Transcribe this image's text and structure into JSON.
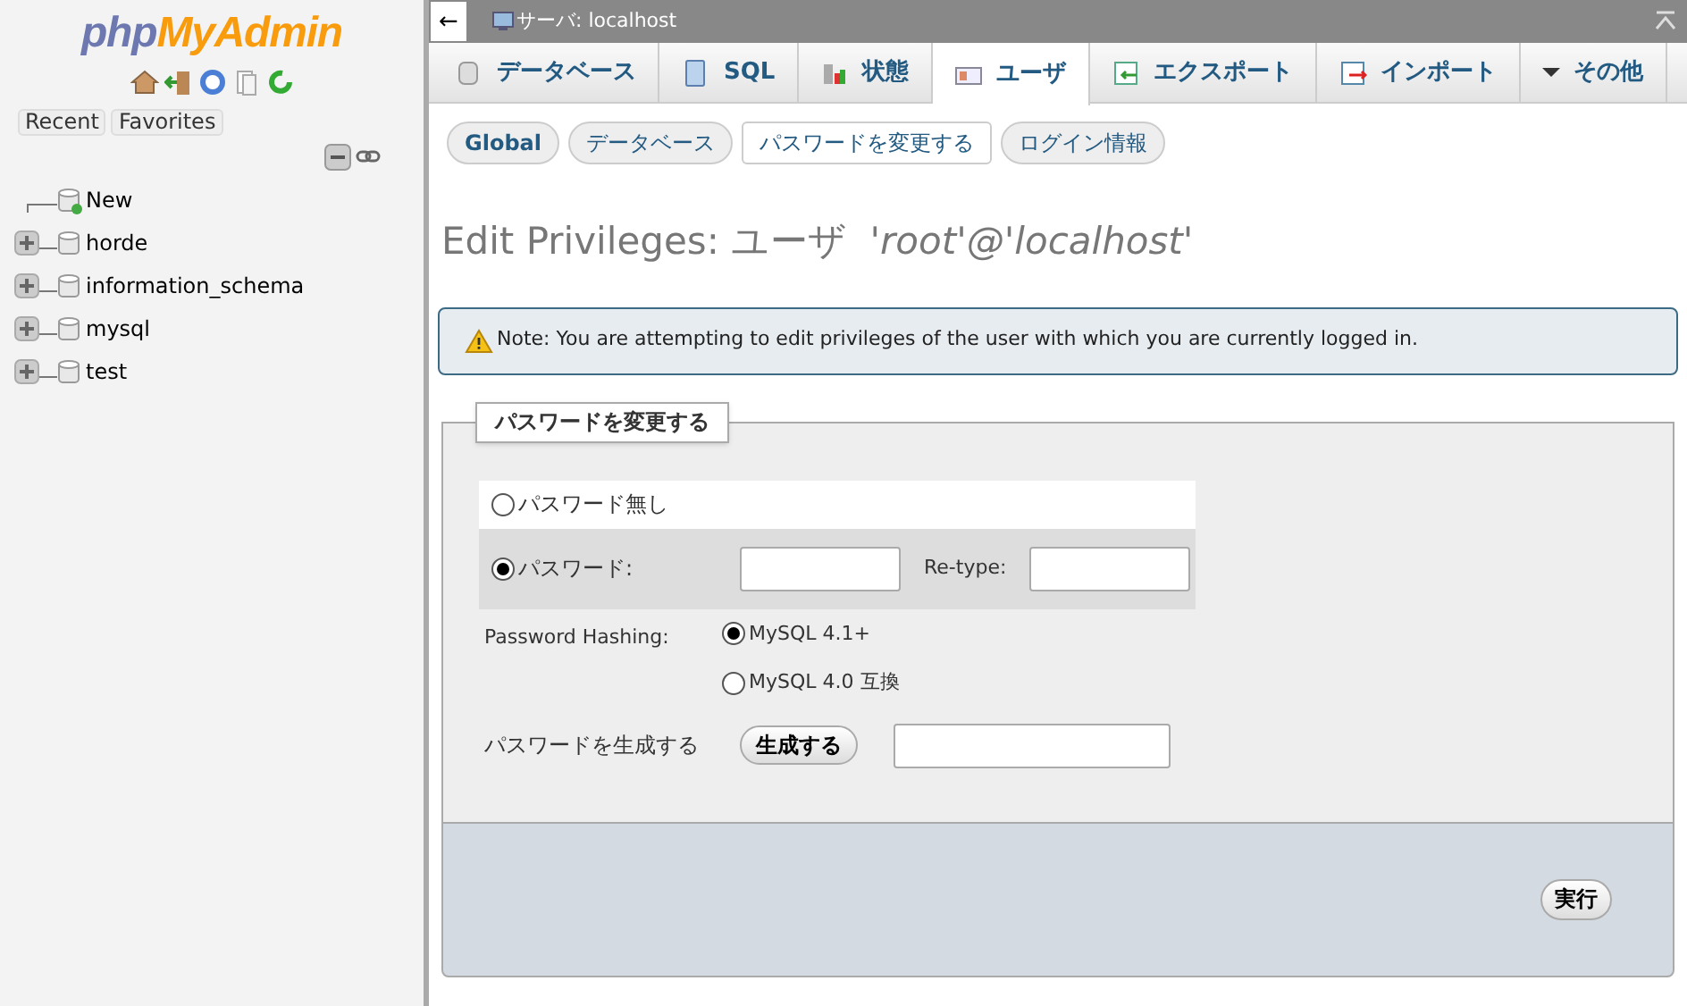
{
  "logo": {
    "php": "php",
    "admin": "MyAdmin"
  },
  "sidebar_tabs": [
    "Recent",
    "Favorites"
  ],
  "tree": [
    {
      "kind": "new",
      "label": "New"
    },
    {
      "kind": "db",
      "label": "horde"
    },
    {
      "kind": "db",
      "label": "information_schema"
    },
    {
      "kind": "db",
      "label": "mysql"
    },
    {
      "kind": "db",
      "label": "test"
    }
  ],
  "topbar": {
    "back": "←",
    "server": "サーバ: localhost"
  },
  "tabs": [
    {
      "kind": "db",
      "label": "データベース",
      "selected": false
    },
    {
      "kind": "sql",
      "label": "SQL",
      "selected": false
    },
    {
      "kind": "status",
      "label": "状態",
      "selected": false
    },
    {
      "kind": "user",
      "label": "ユーザ",
      "selected": true
    },
    {
      "kind": "export",
      "label": "エクスポート",
      "selected": false
    },
    {
      "kind": "import",
      "label": "インポート",
      "selected": false
    },
    {
      "kind": "more",
      "label": "その他",
      "selected": false
    }
  ],
  "subtabs": [
    {
      "label": "Global",
      "selected": false
    },
    {
      "label": "データベース",
      "selected": false
    },
    {
      "label": "パスワードを変更する",
      "selected": true
    },
    {
      "label": "ログイン情報",
      "selected": false
    }
  ],
  "heading": {
    "text": "Edit Privileges: ユーザ",
    "user": "'root'@'localhost'"
  },
  "note": "Note: You are attempting to edit privileges of the user with which you are currently logged in.",
  "fieldset": {
    "legend": "パスワードを変更する",
    "password_options": [
      {
        "kind": "none",
        "label": "パスワード無し",
        "selected": false
      },
      {
        "kind": "password",
        "label": "パスワード:",
        "retype": "Re-type:",
        "selected": true
      }
    ],
    "hashing_label": "Password Hashing:",
    "hashing_options": [
      {
        "label": "MySQL 4.1+",
        "selected": true
      },
      {
        "label": "MySQL 4.0 互換",
        "selected": false
      }
    ],
    "generate_label": "パスワードを生成する",
    "generate_button": "生成する"
  },
  "submit": "実行"
}
